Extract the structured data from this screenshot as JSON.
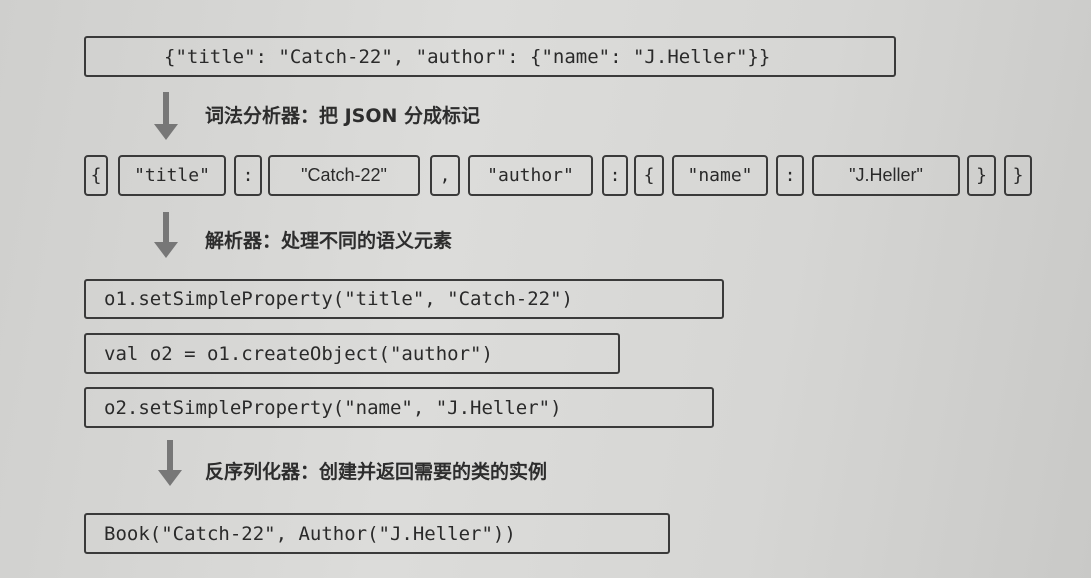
{
  "json_input": "{\"title\": \"Catch-22\", \"author\": {\"name\": \"J.Heller\"}}",
  "steps": [
    {
      "label": "词法分析器：把 JSON 分成标记"
    },
    {
      "label": "解析器：处理不同的语义元素"
    },
    {
      "label": "反序列化器：创建并返回需要的类的实例"
    }
  ],
  "tokens": [
    "{",
    "\"title\"",
    ":",
    "\"Catch-22\"",
    ",",
    "\"author\"",
    ":",
    "{",
    "\"name\"",
    ":",
    "\"J.Heller\"",
    "}",
    "}"
  ],
  "parser_calls": [
    "o1.setSimpleProperty(\"title\", \"Catch-22\")",
    "val o2 = o1.createObject(\"author\")",
    "o2.setSimpleProperty(\"name\", \"J.Heller\")"
  ],
  "result": "Book(\"Catch-22\", Author(\"J.Heller\"))"
}
